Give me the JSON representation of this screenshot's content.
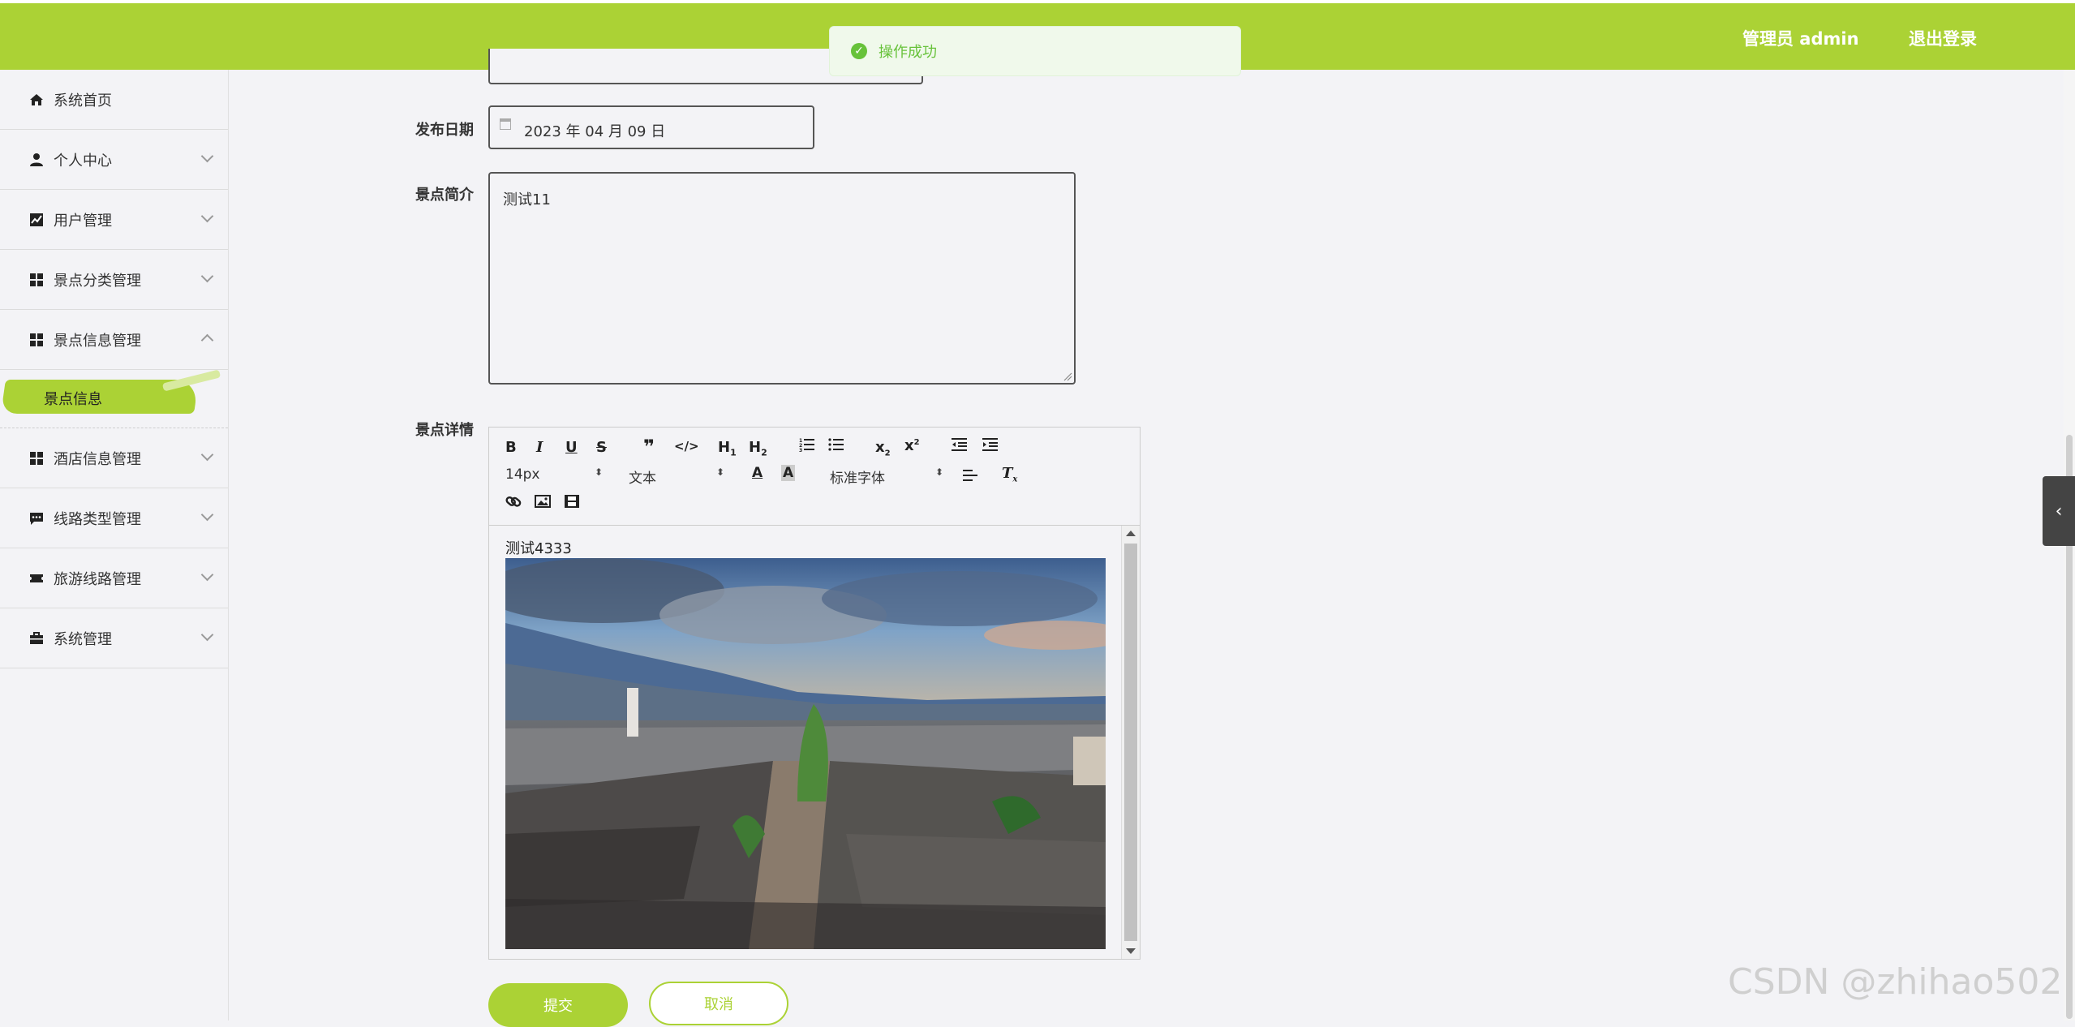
{
  "header": {
    "user_text": "管理员 admin",
    "logout_label": "退出登录",
    "bg_color": "#abd235"
  },
  "toast": {
    "message": "操作成功",
    "icon": "success-check-icon"
  },
  "sidebar": {
    "items": [
      {
        "label": "系统首页",
        "icon": "home-icon"
      },
      {
        "label": "个人中心",
        "icon": "user-icon"
      },
      {
        "label": "用户管理",
        "icon": "trend-chart-icon"
      },
      {
        "label": "景点分类管理",
        "icon": "grid-icon"
      },
      {
        "label": "景点信息管理",
        "icon": "grid-icon"
      },
      {
        "label": "酒店信息管理",
        "icon": "grid-icon"
      },
      {
        "label": "线路类型管理",
        "icon": "chat-icon"
      },
      {
        "label": "旅游线路管理",
        "icon": "ticket-icon"
      },
      {
        "label": "系统管理",
        "icon": "briefcase-icon"
      }
    ],
    "active_sub": "景点信息"
  },
  "form": {
    "date_label": "发布日期",
    "date_value": "2023 年 04 月 09 日",
    "intro_label": "景点简介",
    "intro_value": "测试11",
    "detail_label": "景点详情",
    "editor": {
      "font_size": "14px",
      "format": "文本",
      "font_family": "标准字体",
      "content_text": "测试4333"
    },
    "submit_label": "提交",
    "cancel_label": "取消"
  },
  "watermark": "CSDN @zhihao502"
}
